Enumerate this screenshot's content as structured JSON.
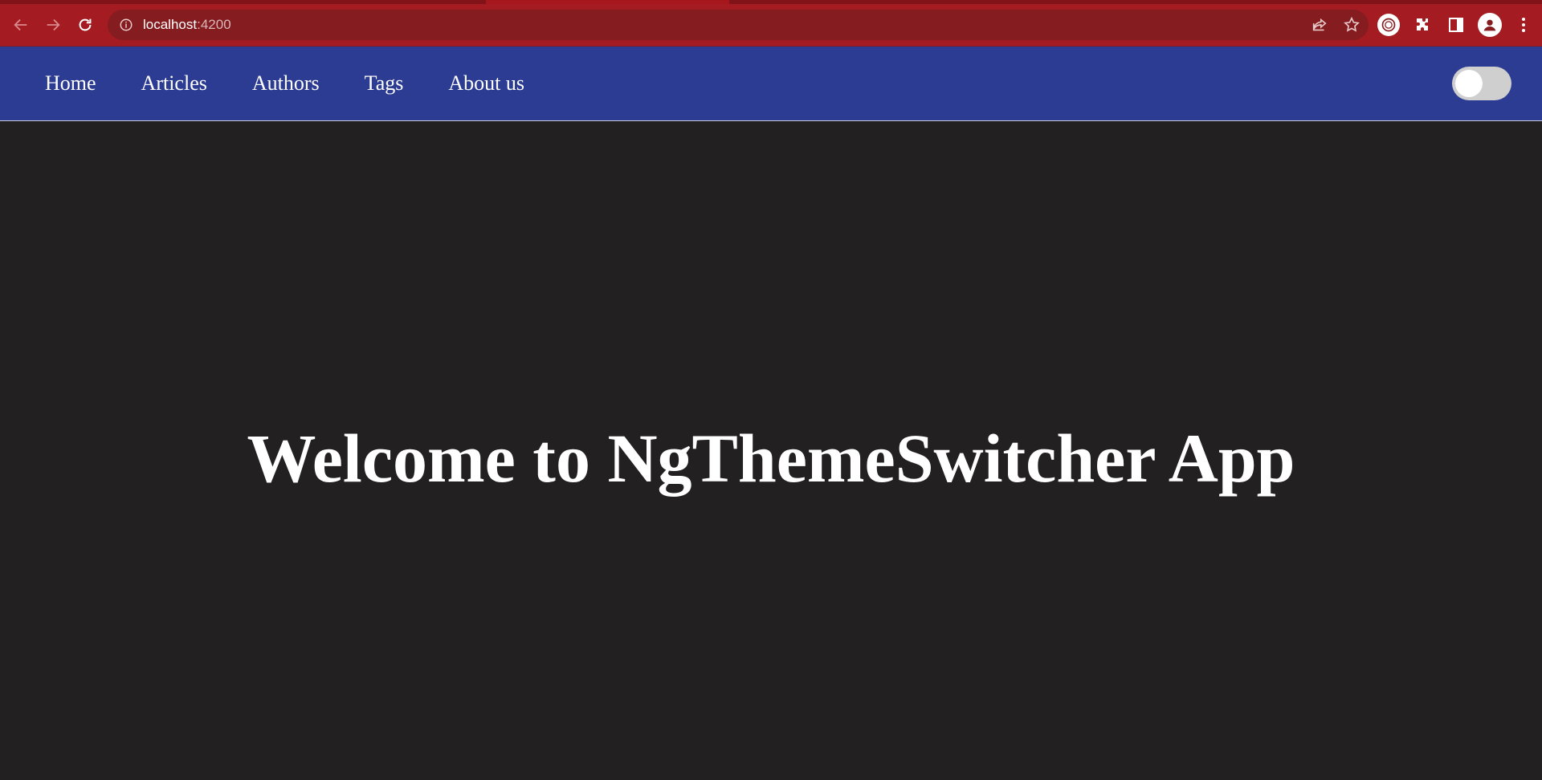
{
  "browser": {
    "url_host": "localhost",
    "url_port": ":4200",
    "icons": {
      "back": "arrow-left-icon",
      "forward": "arrow-right-icon",
      "reload": "reload-icon",
      "site_info": "info-icon",
      "share": "share-icon",
      "bookmark": "star-icon",
      "profile_ext": "extension-profile-icon",
      "extensions": "puzzle-icon",
      "side_panel": "side-panel-icon",
      "account": "avatar-icon",
      "menu": "kebab-menu-icon"
    },
    "colors": {
      "chrome": "#a41b21",
      "omnibox": "#841c20"
    }
  },
  "header": {
    "nav": [
      {
        "label": "Home"
      },
      {
        "label": "Articles"
      },
      {
        "label": "Authors"
      },
      {
        "label": "Tags"
      },
      {
        "label": "About us"
      }
    ],
    "theme_toggle": {
      "checked": false
    },
    "colors": {
      "background": "#2c3c93"
    }
  },
  "main": {
    "title": "Welcome to NgThemeSwitcher App",
    "colors": {
      "background": "#232021",
      "text": "#ffffff"
    }
  }
}
